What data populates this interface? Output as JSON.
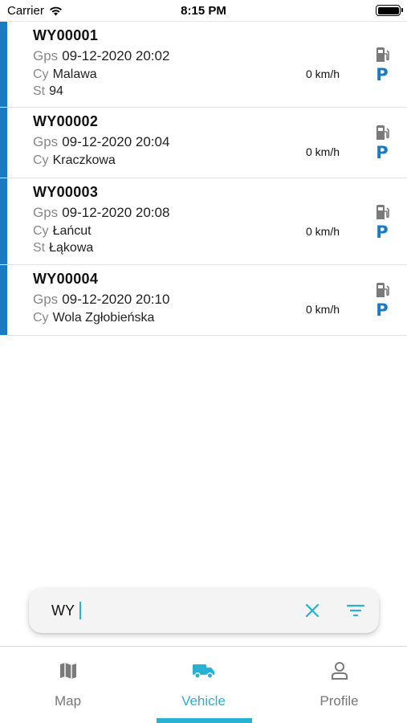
{
  "status_bar": {
    "carrier": "Carrier",
    "time": "8:15 PM",
    "icons": [
      "wifi-icon",
      "battery-icon"
    ]
  },
  "vehicles": [
    {
      "plate": "WY00001",
      "gps_key": "Gps",
      "gps_value": "09-12-2020 20:02",
      "city_key": "Cy",
      "city_value": "Malawa",
      "street_key": "St",
      "street_value": "94",
      "speed": "0 km/h"
    },
    {
      "plate": "WY00002",
      "gps_key": "Gps",
      "gps_value": "09-12-2020 20:04",
      "city_key": "Cy",
      "city_value": "Kraczkowa",
      "speed": "0 km/h"
    },
    {
      "plate": "WY00003",
      "gps_key": "Gps",
      "gps_value": "09-12-2020 20:08",
      "city_key": "Cy",
      "city_value": "Łańcut",
      "street_key": "St",
      "street_value": "Łąkowa",
      "speed": "0 km/h"
    },
    {
      "plate": "WY00004",
      "gps_key": "Gps",
      "gps_value": "09-12-2020 20:10",
      "city_key": "Cy",
      "city_value": "Wola Zgłobieńska",
      "speed": "0 km/h"
    }
  ],
  "row_icons": {
    "fuel_icon": "fuel-pump-icon",
    "parking_label": "P"
  },
  "search": {
    "value": "WY",
    "clear_icon": "close-icon",
    "filter_icon": "filter-icon"
  },
  "tabs": [
    {
      "label": "Map",
      "icon": "map-icon",
      "active": false
    },
    {
      "label": "Vehicle",
      "icon": "truck-icon",
      "active": true
    },
    {
      "label": "Profile",
      "icon": "person-icon",
      "active": false
    }
  ],
  "colors": {
    "accent_blue": "#1a7bc2",
    "active_tab": "#27b1d3",
    "muted_key": "#888888",
    "icon_gray": "#7a7a7a"
  }
}
